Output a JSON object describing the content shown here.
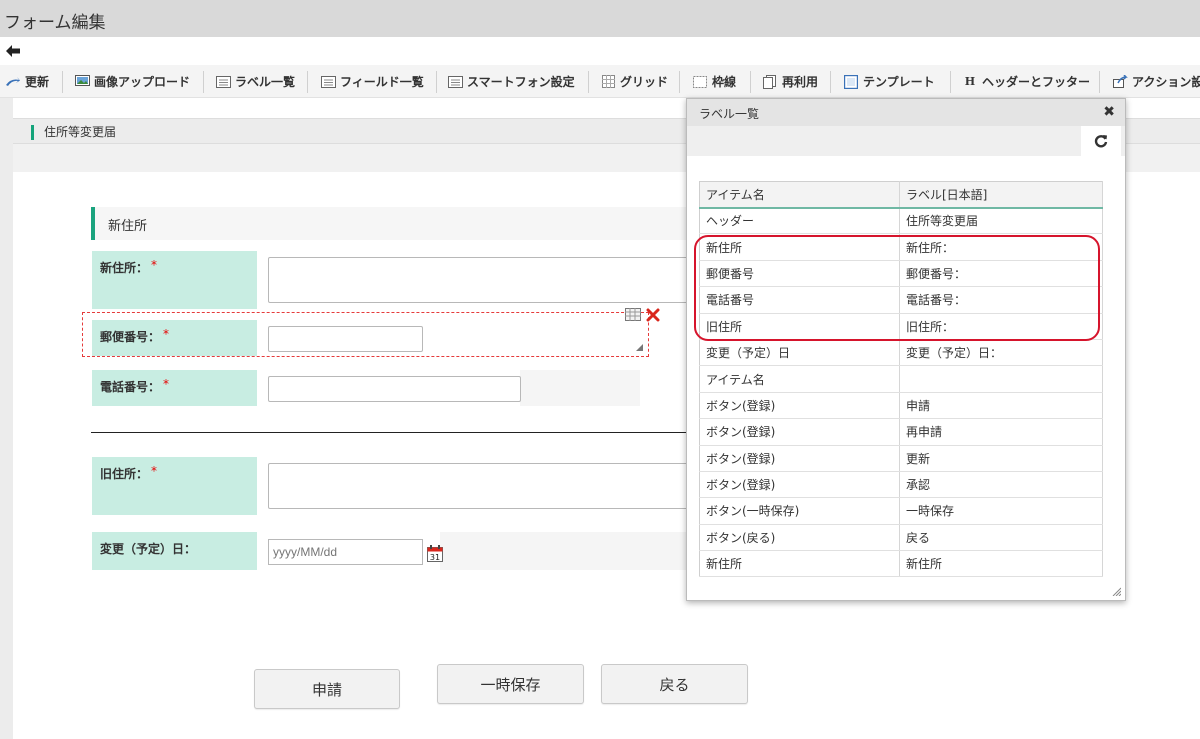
{
  "window": {
    "title": "フォーム編集"
  },
  "toolbar": {
    "items": [
      {
        "label": "更新",
        "icon": "update-icon"
      },
      {
        "label": "画像アップロード",
        "icon": "image-upload-icon"
      },
      {
        "label": "ラベル一覧",
        "icon": "label-list-icon"
      },
      {
        "label": "フィールド一覧",
        "icon": "field-list-icon"
      },
      {
        "label": "スマートフォン設定",
        "icon": "smartphone-settings-icon"
      },
      {
        "label": "グリッド",
        "icon": "grid-icon"
      },
      {
        "label": "枠線",
        "icon": "border-icon"
      },
      {
        "label": "再利用",
        "icon": "reuse-icon"
      },
      {
        "label": "テンプレート",
        "icon": "template-icon"
      },
      {
        "label": "ヘッダーとフッター",
        "icon": "header-footer-icon"
      },
      {
        "label": "アクション設",
        "icon": "action-settings-icon"
      }
    ],
    "header_footer_glyph": "H"
  },
  "page": {
    "title": "住所等変更届"
  },
  "form": {
    "section_title": "新住所",
    "fields": [
      {
        "label": "新住所：",
        "required": "*"
      },
      {
        "label": "郵便番号：",
        "required": "*"
      },
      {
        "label": "電話番号：",
        "required": "*"
      },
      {
        "label": "旧住所：",
        "required": "*"
      },
      {
        "label": "変更（予定）日："
      }
    ],
    "date_placeholder": "yyyy/MM/dd",
    "calendar_day": "31",
    "buttons": {
      "apply": "申請",
      "temp_save": "一時保存",
      "back": "戻る"
    }
  },
  "dialog": {
    "title": "ラベル一覧",
    "close": "✖",
    "columns": [
      "アイテム名",
      "ラベル[日本語]"
    ],
    "rows": [
      [
        "ヘッダー",
        "住所等変更届"
      ],
      [
        "新住所",
        "新住所："
      ],
      [
        "郵便番号",
        "郵便番号："
      ],
      [
        "電話番号",
        "電話番号："
      ],
      [
        "旧住所",
        "旧住所："
      ],
      [
        "変更（予定）日",
        "変更（予定）日："
      ],
      [
        "アイテム名",
        ""
      ],
      [
        "ボタン(登録)",
        "申請"
      ],
      [
        "ボタン(登録)",
        "再申請"
      ],
      [
        "ボタン(登録)",
        "更新"
      ],
      [
        "ボタン(登録)",
        "承認"
      ],
      [
        "ボタン(一時保存)",
        "一時保存"
      ],
      [
        "ボタン(戻る)",
        "戻る"
      ],
      [
        "新住所",
        "新住所"
      ]
    ]
  },
  "colors": {
    "label_bg": "#c8ede2",
    "accent": "#1aa37e",
    "required": "#e60000",
    "highlight": "#d6142c"
  }
}
